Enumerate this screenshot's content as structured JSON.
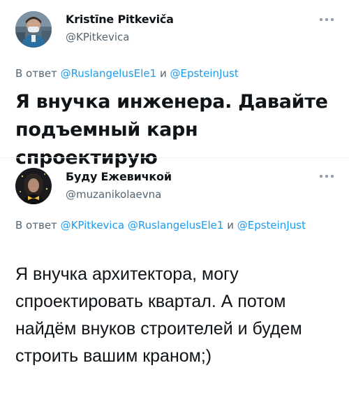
{
  "tweets": [
    {
      "author_name": "Kristīne Pitkeviča",
      "author_handle": "@KPitkevica",
      "reply_prefix": "В ответ",
      "reply_mentions": [
        "@RuslangelusEle1",
        "@EpsteinJust"
      ],
      "reply_joiner": "и",
      "text": "Я внучка инженера. Давайте подъемный карн спроектирую"
    },
    {
      "author_name": "Буду Ежевичкой",
      "author_handle": "@muzanikolaevna",
      "reply_prefix": "В ответ",
      "reply_mentions": [
        "@KPitkevica",
        "@RuslangelusEle1",
        "@EpsteinJust"
      ],
      "reply_joiner": "и",
      "text": "Я внучка архитектора, могу спроектировать квартал. А потом найдём внуков строителей и будем строить вашим краном;)"
    }
  ],
  "colors": {
    "text": "#0f1419",
    "secondary": "#536471",
    "link": "#1d9bf0",
    "more_dots": "#8b98a5"
  },
  "icons": {
    "more": "ellipsis-icon"
  }
}
